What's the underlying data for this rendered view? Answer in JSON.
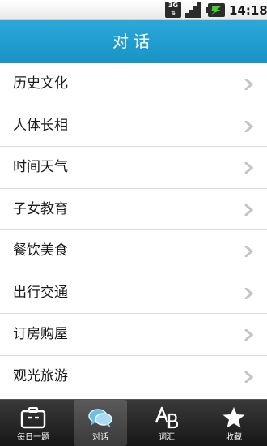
{
  "status_bar": {
    "network": "3G",
    "time": "14:18"
  },
  "header": {
    "title": "对话"
  },
  "list": {
    "items": [
      {
        "label": "历史文化"
      },
      {
        "label": "人体长相"
      },
      {
        "label": "时间天气"
      },
      {
        "label": "子女教育"
      },
      {
        "label": "餐饮美食"
      },
      {
        "label": "出行交通"
      },
      {
        "label": "订房购屋"
      },
      {
        "label": "观光旅游"
      }
    ]
  },
  "bottom_nav": {
    "tabs": [
      {
        "label": "每日一题",
        "icon": "briefcase-icon"
      },
      {
        "label": "对话",
        "icon": "chat-bubbles-icon",
        "active": true
      },
      {
        "label": "词汇",
        "icon": "ab-letters-icon"
      },
      {
        "label": "收藏",
        "icon": "star-icon"
      }
    ]
  },
  "colors": {
    "header_bg": "#1f9dd0",
    "nav_bg": "#262626",
    "battery_bolt": "#3ed22c"
  }
}
